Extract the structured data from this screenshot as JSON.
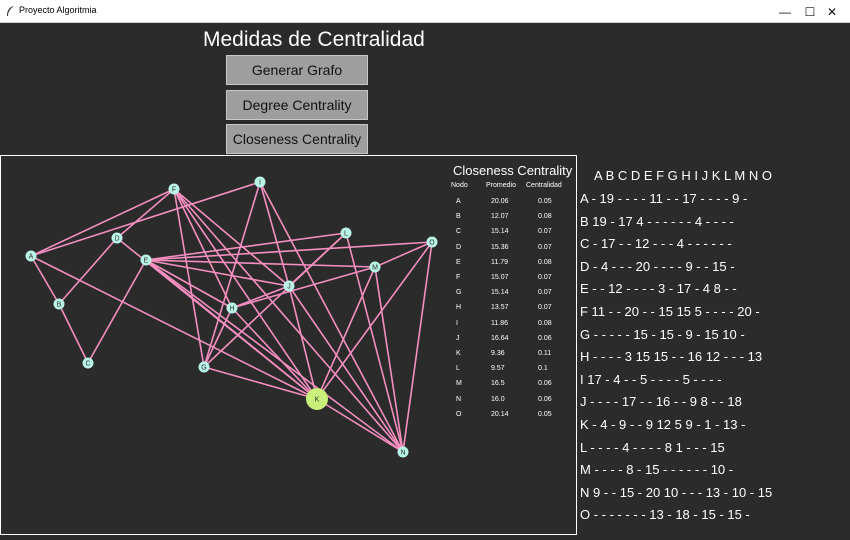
{
  "window": {
    "title": "Proyecto Algoritmia",
    "icon": "feather-icon",
    "controls": [
      "minimize-icon",
      "maximize-icon",
      "close-icon"
    ]
  },
  "header": {
    "title": "Medidas de Centralidad"
  },
  "buttons": {
    "generate": "Generar Grafo",
    "degree": "Degree Centrality",
    "closeness": "Closeness Centrality"
  },
  "colors": {
    "background": "#2b2b2b",
    "edge": "#f48fc0",
    "node": "#b9f5e6",
    "highlight_node": "#c8f07a",
    "button": "#9e9e9e"
  },
  "graph": {
    "highlighted": "K",
    "nodes": [
      "A",
      "B",
      "C",
      "D",
      "E",
      "F",
      "G",
      "H",
      "I",
      "J",
      "K",
      "L",
      "M",
      "N",
      "O"
    ],
    "edges": [
      [
        "A",
        "B"
      ],
      [
        "A",
        "F"
      ],
      [
        "A",
        "I"
      ],
      [
        "A",
        "K"
      ],
      [
        "B",
        "C"
      ],
      [
        "B",
        "D"
      ],
      [
        "C",
        "E"
      ],
      [
        "D",
        "F"
      ],
      [
        "D",
        "K"
      ],
      [
        "E",
        "H"
      ],
      [
        "E",
        "J"
      ],
      [
        "E",
        "K"
      ],
      [
        "E",
        "M"
      ],
      [
        "E",
        "N"
      ],
      [
        "E",
        "O"
      ],
      [
        "E",
        "L"
      ],
      [
        "F",
        "G"
      ],
      [
        "F",
        "K"
      ],
      [
        "F",
        "H"
      ],
      [
        "F",
        "J"
      ],
      [
        "F",
        "N"
      ],
      [
        "G",
        "H"
      ],
      [
        "G",
        "I"
      ],
      [
        "G",
        "L"
      ],
      [
        "G",
        "K"
      ],
      [
        "H",
        "K"
      ],
      [
        "H",
        "M"
      ],
      [
        "H",
        "J"
      ],
      [
        "I",
        "J"
      ],
      [
        "I",
        "N"
      ],
      [
        "J",
        "K"
      ],
      [
        "J",
        "L"
      ],
      [
        "J",
        "N"
      ],
      [
        "K",
        "M"
      ],
      [
        "K",
        "O"
      ],
      [
        "K",
        "N"
      ],
      [
        "L",
        "N"
      ],
      [
        "M",
        "O"
      ],
      [
        "M",
        "N"
      ],
      [
        "O",
        "N"
      ]
    ]
  },
  "closeness": {
    "title": "Closeness Centrality",
    "headers": [
      "Nodo",
      "Promedio",
      "Centralidad"
    ],
    "rows": [
      [
        "A",
        "20.06",
        "0.05"
      ],
      [
        "B",
        "12.07",
        "0.08"
      ],
      [
        "C",
        "15.14",
        "0.07"
      ],
      [
        "D",
        "15.36",
        "0.07"
      ],
      [
        "E",
        "11.79",
        "0.08"
      ],
      [
        "F",
        "15.07",
        "0.07"
      ],
      [
        "G",
        "15.14",
        "0.07"
      ],
      [
        "H",
        "13.57",
        "0.07"
      ],
      [
        "I",
        "11.86",
        "0.08"
      ],
      [
        "J",
        "16.64",
        "0.06"
      ],
      [
        "K",
        "9.36",
        "0.11"
      ],
      [
        "L",
        "9.57",
        "0.1"
      ],
      [
        "M",
        "16.5",
        "0.06"
      ],
      [
        "N",
        "16.0",
        "0.06"
      ],
      [
        "O",
        "20.14",
        "0.05"
      ]
    ]
  },
  "matrix": {
    "header": "A  B  C  D  E  F  G  H  I  J  K  L  M  N  O",
    "rows": [
      "A  -  19  -  -  -  -  11  -  -  17  -  -  -  -  9  -",
      "B 19  -  17  4  -  -  -  -  -  -  4  -  -  -  -",
      "C  -  17  -  -  12  -  -  -  4  -  -  -  -  -  -",
      "D  -  4  -  -  -  20  -  -  -  -  9  -  -  15  -",
      "E  -  -  12  -  -  -  -  3  -  17  -  4  8  -  -",
      "F 11  -  -  20  -  -  15 15  5  -  -  -  -  20  -",
      "G  -  -  -  -  -  15  -  15  -  9  -  15 10  -",
      "H  -  -  -  -  3 15 15  -  -  16 12  -  -  -  13",
      "I 17  -  4  -  -  5  -  -  -  -  5  -  -  -  -",
      "J  -  -  -  -  17  -  -  16  -  -  9  8  -  -  18",
      "K  -  4  -  9  -  -  9 12  5  9  -  1  -  13  -",
      "L  -  -  -  -  4  -  -  -  -  8  1  -  -  -  15",
      "M  -  -  -  -  8  -  15  -  -  -  -  -  -  10  -",
      "N  9  -  -  15  -  20 10  -  -  -  13  -  10  -  15",
      "O  -  -  -  -  -  -  -  13  -  18  -  15  -  15  -"
    ]
  }
}
